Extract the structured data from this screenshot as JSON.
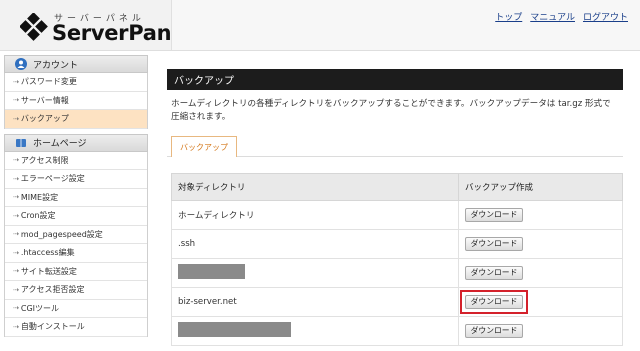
{
  "header": {
    "logo_kana": "サーバーパネル",
    "logo_name": "ServerPanel",
    "links": [
      "トップ",
      "マニュアル",
      "ログアウト"
    ]
  },
  "sidebar": {
    "sections": [
      {
        "title": "アカウント",
        "icon": "user-icon",
        "items": [
          "パスワード変更",
          "サーバー情報",
          "バックアップ"
        ]
      },
      {
        "title": "ホームページ",
        "icon": "book-icon",
        "items": [
          "アクセス制限",
          "エラーページ設定",
          "MIME設定",
          "Cron設定",
          "mod_pagespeed設定",
          ".htaccess編集",
          "サイト転送設定",
          "アクセス拒否設定",
          "CGIツール",
          "自動インストール"
        ]
      }
    ],
    "active_item": "バックアップ"
  },
  "main": {
    "title": "バックアップ",
    "description": "ホームディレクトリの各種ディレクトリをバックアップすることができます。バックアップデータは tar.gz 形式で圧縮されます。",
    "tab": "バックアップ",
    "table": {
      "headers": [
        "対象ディレクトリ",
        "バックアップ作成"
      ],
      "rows": [
        {
          "dir": "ホームディレクトリ",
          "button": "ダウンロード"
        },
        {
          "dir": ".ssh",
          "button": "ダウンロード"
        },
        {
          "dir": "",
          "button": "ダウンロード"
        },
        {
          "dir": "biz-server.net",
          "button": "ダウンロード"
        },
        {
          "dir": "",
          "button": "ダウンロード"
        }
      ]
    }
  },
  "colors": {
    "active_item_bg": "#fde2c2",
    "highlight": "#d4212b",
    "titlebar": "#1c1c1c",
    "tab_text": "#d4781b"
  }
}
